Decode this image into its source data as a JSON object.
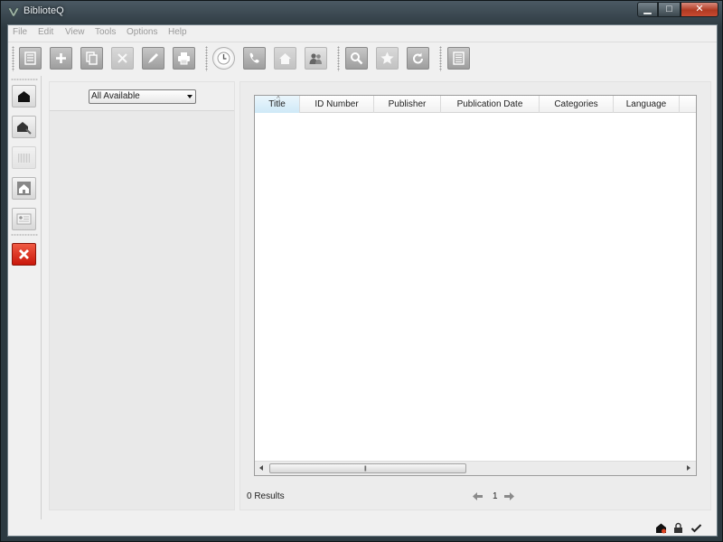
{
  "window": {
    "title": "BiblioteQ",
    "controls": {
      "minimize": "▁",
      "maximize": "□",
      "close": "✕"
    }
  },
  "menu": [
    "File",
    "Edit",
    "View",
    "Tools",
    "Options",
    "Help"
  ],
  "toolbar": {
    "buttons": [
      "list-icon",
      "plus-icon",
      "copy-icon",
      "delete-icon",
      "edit-icon",
      "print-icon",
      "clock-icon",
      "phone-icon",
      "house-icon",
      "members-icon",
      "magnifier-icon",
      "star-icon",
      "refresh-icon",
      "details-icon"
    ]
  },
  "sidebar": {
    "buttons": [
      "connect-icon",
      "disconnect-icon",
      "books-icon",
      "home-icon",
      "id-card-icon",
      "exit-icon"
    ]
  },
  "filter": {
    "selected": "All Available"
  },
  "table": {
    "columns": [
      "Title",
      "ID Number",
      "Publisher",
      "Publication Date",
      "Categories",
      "Language"
    ],
    "sorted_column": "Title",
    "rows": []
  },
  "results": {
    "label": "0 Results"
  },
  "pager": {
    "page": "1"
  },
  "status_icons": [
    "status-db-icon",
    "lock-icon",
    "check-icon"
  ],
  "colors": {
    "accent_red": "#c9170b",
    "header_sorted": "#cfe9f7"
  }
}
